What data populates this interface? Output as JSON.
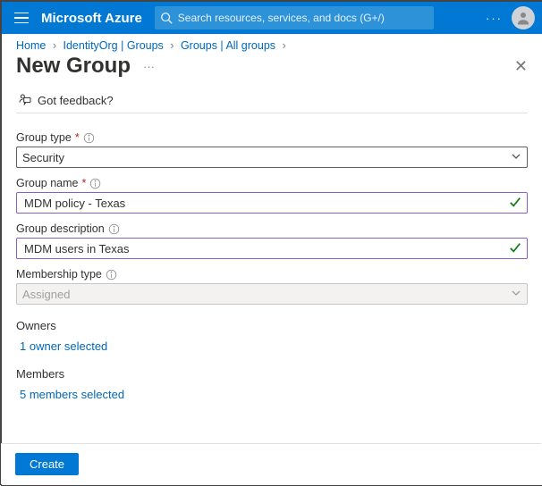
{
  "header": {
    "brand": "Microsoft Azure",
    "search_placeholder": "Search resources, services, and docs (G+/)"
  },
  "breadcrumbs": [
    {
      "label": "Home"
    },
    {
      "label": "IdentityOrg | Groups"
    },
    {
      "label": "Groups | All groups"
    }
  ],
  "page": {
    "title": "New Group",
    "feedback_label": "Got feedback?"
  },
  "form": {
    "group_type": {
      "label": "Group type",
      "value": "Security"
    },
    "group_name": {
      "label": "Group name",
      "value": "MDM policy - Texas"
    },
    "group_description": {
      "label": "Group description",
      "value": "MDM users in Texas"
    },
    "membership_type": {
      "label": "Membership type",
      "value": "Assigned"
    },
    "owners": {
      "label": "Owners",
      "link": "1 owner selected"
    },
    "members": {
      "label": "Members",
      "link": "5 members selected"
    }
  },
  "footer": {
    "create_label": "Create"
  }
}
